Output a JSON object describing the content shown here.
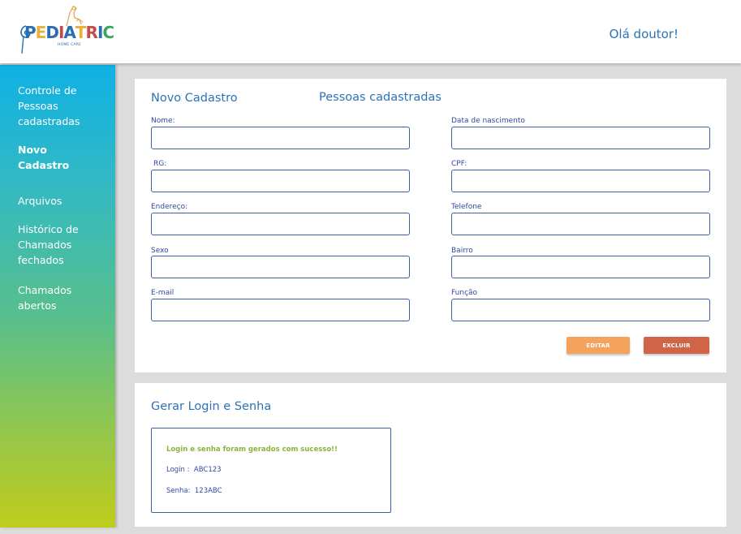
{
  "header": {
    "logo_text": "PEDIATRIC",
    "logo_subtitle": "HOME CARE",
    "greeting": "Olá doutor!"
  },
  "sidebar": {
    "items": [
      {
        "label": "Controle de Pessoas cadastradas",
        "active": false
      },
      {
        "label": "Novo Cadastro",
        "active": true
      },
      {
        "label": "Arquivos",
        "active": false
      },
      {
        "label": "Histórico de Chamados fechados",
        "active": false
      },
      {
        "label": "Chamados abertos",
        "active": false
      }
    ]
  },
  "form": {
    "tab_new": "Novo Cadastro",
    "tab_registered": "Pessoas cadastradas",
    "fields": {
      "nome": {
        "label": "Nome:",
        "value": ""
      },
      "data_nascimento": {
        "label": "Data de nascimento",
        "value": ""
      },
      "rg": {
        "label": "RG:",
        "value": ""
      },
      "cpf": {
        "label": "CPF:",
        "value": ""
      },
      "endereco": {
        "label": "Endereço:",
        "value": ""
      },
      "telefone": {
        "label": "Telefone",
        "value": ""
      },
      "sexo": {
        "label": "Sexo",
        "value": ""
      },
      "bairro": {
        "label": "Bairro",
        "value": ""
      },
      "email": {
        "label": "E-mail",
        "value": ""
      },
      "funcao": {
        "label": "Função",
        "value": ""
      }
    },
    "edit_label": "EDITAR",
    "delete_label": "EXCLUIR"
  },
  "login": {
    "title": "Gerar Login e Senha",
    "success_message": "Login e senha foram gerados com sucesso!!",
    "login_label": "Login :",
    "login_value": "ABC123",
    "password_label": "Senha:",
    "password_value": "123ABC"
  },
  "colors": {
    "accent_blue": "#2a73b8",
    "edit_button": "#f3a35d",
    "delete_button": "#cf6448",
    "success_green": "#8cb33a"
  }
}
